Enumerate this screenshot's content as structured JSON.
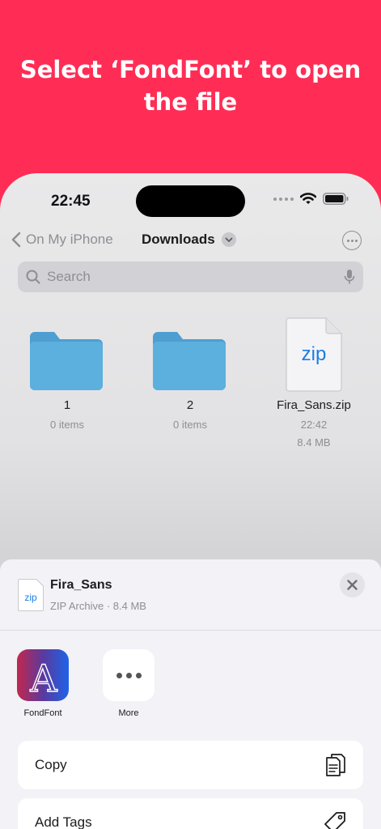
{
  "headline": {
    "line1": "Select ‘FondFont’ to open",
    "line2": "the file"
  },
  "status_bar": {
    "time": "22:45",
    "icons": [
      "cellular-signal-icon",
      "wifi-icon",
      "battery-icon"
    ]
  },
  "nav": {
    "back_label": "On My iPhone",
    "title": "Downloads"
  },
  "search": {
    "placeholder": "Search"
  },
  "files": [
    {
      "name": "1",
      "meta": "0 items",
      "type": "folder"
    },
    {
      "name": "2",
      "meta": "0 items",
      "type": "folder"
    },
    {
      "name": "Fira_Sans.zip",
      "meta": "22:42",
      "size": "8.4 MB",
      "type": "zip",
      "thumb_label": "zip"
    }
  ],
  "share_sheet": {
    "file_name": "Fira_Sans",
    "file_info": "ZIP Archive · 8.4 MB",
    "thumb_label": "zip",
    "apps": [
      {
        "label": "FondFont",
        "icon": "fondfont-app-icon",
        "glyph": "A"
      },
      {
        "label": "More",
        "icon": "more-dots-icon"
      }
    ],
    "actions": [
      {
        "label": "Copy",
        "icon": "copy-icon"
      },
      {
        "label": "Add Tags",
        "icon": "tag-icon"
      }
    ]
  },
  "colors": {
    "background": "#ff2d55",
    "folder": "#5aa9d9",
    "accent": "#1a7de6"
  }
}
